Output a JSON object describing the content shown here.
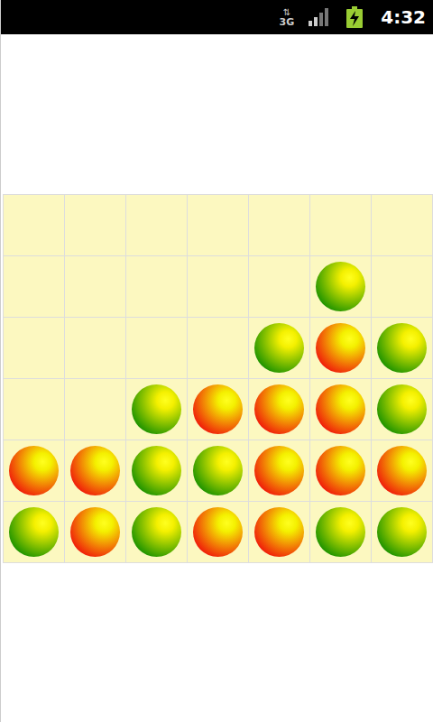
{
  "status_bar": {
    "network": "3G",
    "time": "4:32"
  },
  "board": {
    "rows": [
      [
        {
          "kind": "empty"
        },
        {
          "kind": "empty"
        },
        {
          "kind": "empty"
        },
        {
          "kind": "empty"
        },
        {
          "kind": "empty"
        },
        {
          "kind": "empty"
        },
        {
          "kind": "empty"
        }
      ],
      [
        {
          "kind": "empty"
        },
        {
          "kind": "empty"
        },
        {
          "kind": "empty"
        },
        {
          "kind": "empty"
        },
        {
          "kind": "empty"
        },
        {
          "kind": "piece",
          "color": "#1f9400"
        },
        {
          "kind": "empty"
        }
      ],
      [
        {
          "kind": "empty"
        },
        {
          "kind": "empty"
        },
        {
          "kind": "empty"
        },
        {
          "kind": "empty"
        },
        {
          "kind": "piece",
          "color": "#1f9400"
        },
        {
          "kind": "piece",
          "color": "#f01e0a"
        },
        {
          "kind": "piece",
          "color": "#1f9400"
        }
      ],
      [
        {
          "kind": "empty"
        },
        {
          "kind": "empty"
        },
        {
          "kind": "piece",
          "color": "#1f9400"
        },
        {
          "kind": "piece",
          "color": "#f01e0a"
        },
        {
          "kind": "piece",
          "color": "#f01e0a"
        },
        {
          "kind": "piece",
          "color": "#f01e0a"
        },
        {
          "kind": "piece",
          "color": "#1f9400"
        }
      ],
      [
        {
          "kind": "piece",
          "color": "#f01e0a"
        },
        {
          "kind": "piece",
          "color": "#f01e0a"
        },
        {
          "kind": "piece",
          "color": "#1f9400"
        },
        {
          "kind": "piece",
          "color": "#1f9400"
        },
        {
          "kind": "piece",
          "color": "#f01e0a"
        },
        {
          "kind": "piece",
          "color": "#f01e0a"
        },
        {
          "kind": "piece",
          "color": "#f01e0a"
        }
      ],
      [
        {
          "kind": "piece",
          "color": "#1f9400"
        },
        {
          "kind": "piece",
          "color": "#f01e0a"
        },
        {
          "kind": "piece",
          "color": "#1f9400"
        },
        {
          "kind": "piece",
          "color": "#f01e0a"
        },
        {
          "kind": "piece",
          "color": "#f01e0a"
        },
        {
          "kind": "piece",
          "color": "#1f9400"
        },
        {
          "kind": "piece",
          "color": "#1f9400"
        }
      ]
    ]
  }
}
